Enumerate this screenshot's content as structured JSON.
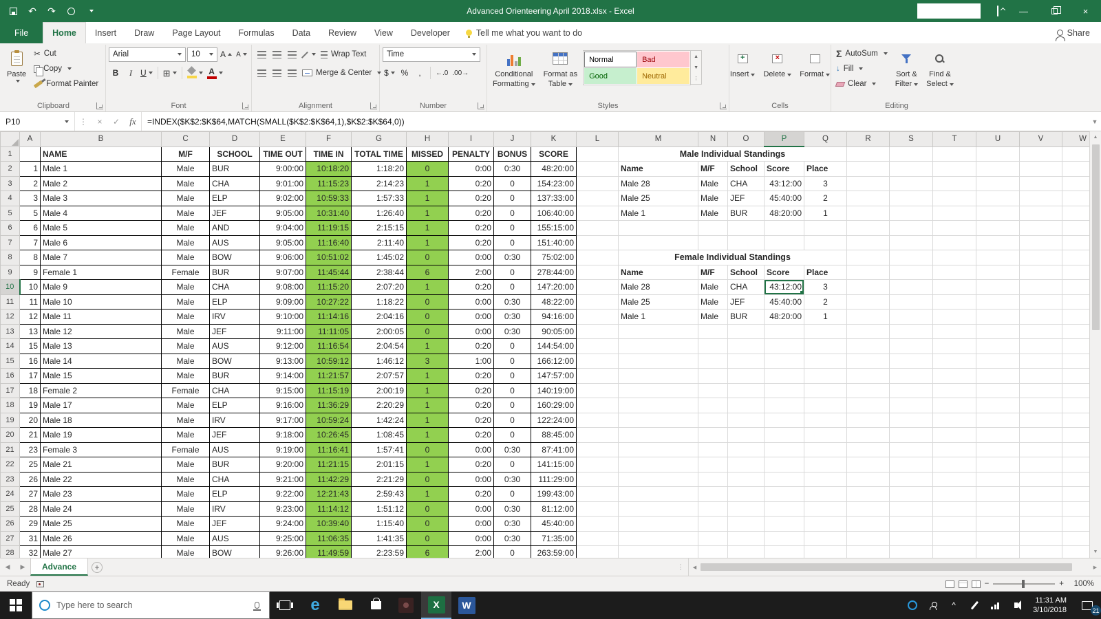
{
  "titlebar": {
    "title": "Advanced Orienteering April 2018.xlsx - Excel"
  },
  "ribbon": {
    "tabs": [
      "File",
      "Home",
      "Insert",
      "Draw",
      "Page Layout",
      "Formulas",
      "Data",
      "Review",
      "View",
      "Developer"
    ],
    "active_tab": "Home",
    "tell_me": "Tell me what you want to do",
    "share_label": "Share",
    "groups": {
      "clipboard": {
        "label": "Clipboard",
        "paste": "Paste",
        "cut": "Cut",
        "copy": "Copy",
        "format_painter": "Format Painter"
      },
      "font": {
        "label": "Font",
        "name": "Arial",
        "size": "10"
      },
      "alignment": {
        "label": "Alignment",
        "wrap": "Wrap Text",
        "merge": "Merge & Center"
      },
      "number": {
        "label": "Number",
        "format": "Time"
      },
      "styles": {
        "label": "Styles",
        "conditional_line1": "Conditional",
        "conditional_line2": "Formatting",
        "table_line1": "Format as",
        "table_line2": "Table",
        "gallery": [
          {
            "label": "Normal",
            "bg": "#ffffff",
            "fg": "#000000"
          },
          {
            "label": "Bad",
            "bg": "#ffc7ce",
            "fg": "#9c0006"
          },
          {
            "label": "Good",
            "bg": "#c6efce",
            "fg": "#006100"
          },
          {
            "label": "Neutral",
            "bg": "#ffeb9c",
            "fg": "#9c6500"
          }
        ]
      },
      "cells": {
        "label": "Cells",
        "insert": "Insert",
        "delete": "Delete",
        "format": "Format"
      },
      "editing": {
        "label": "Editing",
        "autosum": "AutoSum",
        "fill": "Fill",
        "clear": "Clear",
        "sort_line1": "Sort &",
        "sort_line2": "Filter",
        "find_line1": "Find &",
        "find_line2": "Select"
      }
    }
  },
  "formula_bar": {
    "name_box": "P10",
    "formula": "=INDEX($K$2:$K$64,MATCH(SMALL($K$2:$K$64,1),$K$2:$K$64,0))"
  },
  "sheet": {
    "columns": [
      "A",
      "B",
      "C",
      "D",
      "E",
      "F",
      "G",
      "H",
      "I",
      "J",
      "K",
      "L",
      "M",
      "N",
      "O",
      "P",
      "Q",
      "R",
      "S",
      "T",
      "U",
      "V",
      "W"
    ],
    "selected": {
      "cell": "P10",
      "col": "P",
      "row": 10
    },
    "main_table": {
      "headers": {
        "name": "NAME",
        "mf": "M/F",
        "school": "SCHOOL",
        "out": "TIME OUT",
        "in": "TIME IN",
        "total": "TOTAL TIME",
        "missed": "MISSED",
        "penalty": "PENALTY",
        "bonus": "BONUS",
        "score": "SCORE"
      },
      "rows": [
        [
          "1",
          "Male 1",
          "Male",
          "BUR",
          "9:00:00",
          "10:18:20",
          "1:18:20",
          "0",
          "0:00",
          "0:30",
          "48:20:00"
        ],
        [
          "2",
          "Male 2",
          "Male",
          "CHA",
          "9:01:00",
          "11:15:23",
          "2:14:23",
          "1",
          "0:20",
          "0",
          "154:23:00"
        ],
        [
          "3",
          "Male 3",
          "Male",
          "ELP",
          "9:02:00",
          "10:59:33",
          "1:57:33",
          "1",
          "0:20",
          "0",
          "137:33:00"
        ],
        [
          "5",
          "Male 4",
          "Male",
          "JEF",
          "9:05:00",
          "10:31:40",
          "1:26:40",
          "1",
          "0:20",
          "0",
          "106:40:00"
        ],
        [
          "6",
          "Male 5",
          "Male",
          "AND",
          "9:04:00",
          "11:19:15",
          "2:15:15",
          "1",
          "0:20",
          "0",
          "155:15:00"
        ],
        [
          "7",
          "Male 6",
          "Male",
          "AUS",
          "9:05:00",
          "11:16:40",
          "2:11:40",
          "1",
          "0:20",
          "0",
          "151:40:00"
        ],
        [
          "8",
          "Male 7",
          "Male",
          "BOW",
          "9:06:00",
          "10:51:02",
          "1:45:02",
          "0",
          "0:00",
          "0:30",
          "75:02:00"
        ],
        [
          "9",
          "Female 1",
          "Female",
          "BUR",
          "9:07:00",
          "11:45:44",
          "2:38:44",
          "6",
          "2:00",
          "0",
          "278:44:00"
        ],
        [
          "10",
          "Male 9",
          "Male",
          "CHA",
          "9:08:00",
          "11:15:20",
          "2:07:20",
          "1",
          "0:20",
          "0",
          "147:20:00"
        ],
        [
          "11",
          "Male 10",
          "Male",
          "ELP",
          "9:09:00",
          "10:27:22",
          "1:18:22",
          "0",
          "0:00",
          "0:30",
          "48:22:00"
        ],
        [
          "12",
          "Male 11",
          "Male",
          "IRV",
          "9:10:00",
          "11:14:16",
          "2:04:16",
          "0",
          "0:00",
          "0:30",
          "94:16:00"
        ],
        [
          "13",
          "Male 12",
          "Male",
          "JEF",
          "9:11:00",
          "11:11:05",
          "2:00:05",
          "0",
          "0:00",
          "0:30",
          "90:05:00"
        ],
        [
          "15",
          "Male 13",
          "Male",
          "AUS",
          "9:12:00",
          "11:16:54",
          "2:04:54",
          "1",
          "0:20",
          "0",
          "144:54:00"
        ],
        [
          "16",
          "Male 14",
          "Male",
          "BOW",
          "9:13:00",
          "10:59:12",
          "1:46:12",
          "3",
          "1:00",
          "0",
          "166:12:00"
        ],
        [
          "17",
          "Male 15",
          "Male",
          "BUR",
          "9:14:00",
          "11:21:57",
          "2:07:57",
          "1",
          "0:20",
          "0",
          "147:57:00"
        ],
        [
          "18",
          "Female 2",
          "Female",
          "CHA",
          "9:15:00",
          "11:15:19",
          "2:00:19",
          "1",
          "0:20",
          "0",
          "140:19:00"
        ],
        [
          "19",
          "Male 17",
          "Male",
          "ELP",
          "9:16:00",
          "11:36:29",
          "2:20:29",
          "1",
          "0:20",
          "0",
          "160:29:00"
        ],
        [
          "20",
          "Male 18",
          "Male",
          "IRV",
          "9:17:00",
          "10:59:24",
          "1:42:24",
          "1",
          "0:20",
          "0",
          "122:24:00"
        ],
        [
          "21",
          "Male 19",
          "Male",
          "JEF",
          "9:18:00",
          "10:26:45",
          "1:08:45",
          "1",
          "0:20",
          "0",
          "88:45:00"
        ],
        [
          "23",
          "Female 3",
          "Female",
          "AUS",
          "9:19:00",
          "11:16:41",
          "1:57:41",
          "0",
          "0:00",
          "0:30",
          "87:41:00"
        ],
        [
          "25",
          "Male 21",
          "Male",
          "BUR",
          "9:20:00",
          "11:21:15",
          "2:01:15",
          "1",
          "0:20",
          "0",
          "141:15:00"
        ],
        [
          "26",
          "Male 22",
          "Male",
          "CHA",
          "9:21:00",
          "11:42:29",
          "2:21:29",
          "0",
          "0:00",
          "0:30",
          "111:29:00"
        ],
        [
          "27",
          "Male 23",
          "Male",
          "ELP",
          "9:22:00",
          "12:21:43",
          "2:59:43",
          "1",
          "0:20",
          "0",
          "199:43:00"
        ],
        [
          "28",
          "Male 24",
          "Male",
          "IRV",
          "9:23:00",
          "11:14:12",
          "1:51:12",
          "0",
          "0:00",
          "0:30",
          "81:12:00"
        ],
        [
          "29",
          "Male 25",
          "Male",
          "JEF",
          "9:24:00",
          "10:39:40",
          "1:15:40",
          "0",
          "0:00",
          "0:30",
          "45:40:00"
        ],
        [
          "31",
          "Male 26",
          "Male",
          "AUS",
          "9:25:00",
          "11:06:35",
          "1:41:35",
          "0",
          "0:00",
          "0:30",
          "71:35:00"
        ],
        [
          "32",
          "Male 27",
          "Male",
          "BOW",
          "9:26:00",
          "11:49:59",
          "2:23:59",
          "6",
          "2:00",
          "0",
          "263:59:00"
        ]
      ]
    },
    "male_standings": {
      "title": "Male Individual Standings",
      "headers": [
        "Name",
        "M/F",
        "School",
        "Score",
        "Place"
      ],
      "rows": [
        [
          "Male 28",
          "Male",
          "CHA",
          "43:12:00",
          "3"
        ],
        [
          "Male 25",
          "Male",
          "JEF",
          "45:40:00",
          "2"
        ],
        [
          "Male 1",
          "Male",
          "BUR",
          "48:20:00",
          "1"
        ]
      ]
    },
    "female_standings": {
      "title": "Female Individual Standings",
      "headers": [
        "Name",
        "M/F",
        "School",
        "Score",
        "Place"
      ],
      "rows": [
        [
          "Male 28",
          "Male",
          "CHA",
          "43:12:00",
          "3"
        ],
        [
          "Male 25",
          "Male",
          "JEF",
          "45:40:00",
          "2"
        ],
        [
          "Male 1",
          "Male",
          "BUR",
          "48:20:00",
          "1"
        ]
      ]
    }
  },
  "sheet_tabs": {
    "active": "Advance"
  },
  "status_bar": {
    "ready": "Ready",
    "zoom": "100%"
  },
  "taskbar": {
    "search_placeholder": "Type here to search",
    "clock_time": "11:31 AM",
    "clock_date": "3/10/2018",
    "notification_count": "21"
  },
  "icons": {
    "cut": "✂",
    "fx": "fx",
    "sigma": "Σ",
    "bold": "B",
    "italic": "I",
    "underline": "U",
    "dollar": "$",
    "percent": "%",
    "comma": ",",
    "inc_decimal": "←.0",
    "dec_decimal": ".00→",
    "letter_a": "A",
    "check": "✓",
    "cancel": "×",
    "close": "×",
    "minimize": "—",
    "undo": "↶",
    "redo": "↷",
    "fill_arrow": "↓",
    "borders": "⊞",
    "nav_left": "◀",
    "nav_right": "▶",
    "scroll_up": "▲",
    "scroll_down": "▼",
    "plus": "+",
    "zoom_minus": "−",
    "zoom_plus": "+",
    "chevron_up": "^",
    "vdots": "⋮",
    "edge_e": "e",
    "excel_x": "X",
    "word_w": "W"
  }
}
